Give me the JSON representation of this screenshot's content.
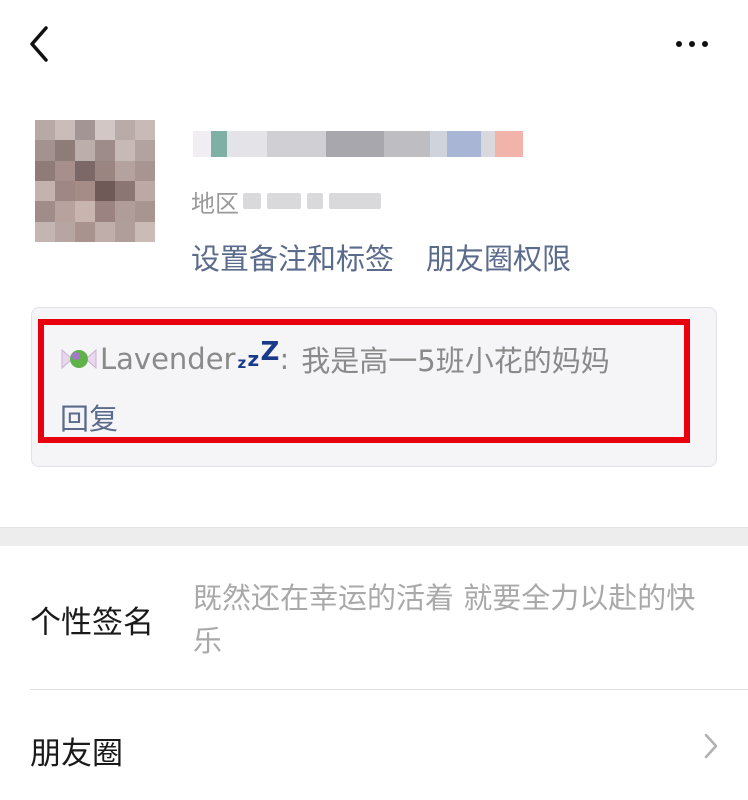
{
  "header": {
    "back_icon": "chevron-left-icon",
    "more_icon": "more-dots-icon"
  },
  "profile": {
    "region_label": "地区",
    "links": [
      "设置备注和标签",
      "朋友圈权限"
    ]
  },
  "greeting": {
    "sender_name": "Lavender",
    "zzz": [
      "z",
      "z",
      "Z"
    ],
    "separator": ":",
    "message": "我是高一5班小花的妈妈",
    "reply_label": "回复",
    "highlight_color": "#e8000e"
  },
  "signature": {
    "label": "个性签名",
    "value": "既然还在幸运的活着 就要全力以赴的快乐"
  },
  "moments": {
    "label": "朋友圈",
    "chevron_icon": "chevron-right-icon"
  },
  "colors": {
    "link": "#5b6b8c",
    "muted": "#a9a9a9",
    "highlight": "#e8000e",
    "band": "#ededed"
  }
}
